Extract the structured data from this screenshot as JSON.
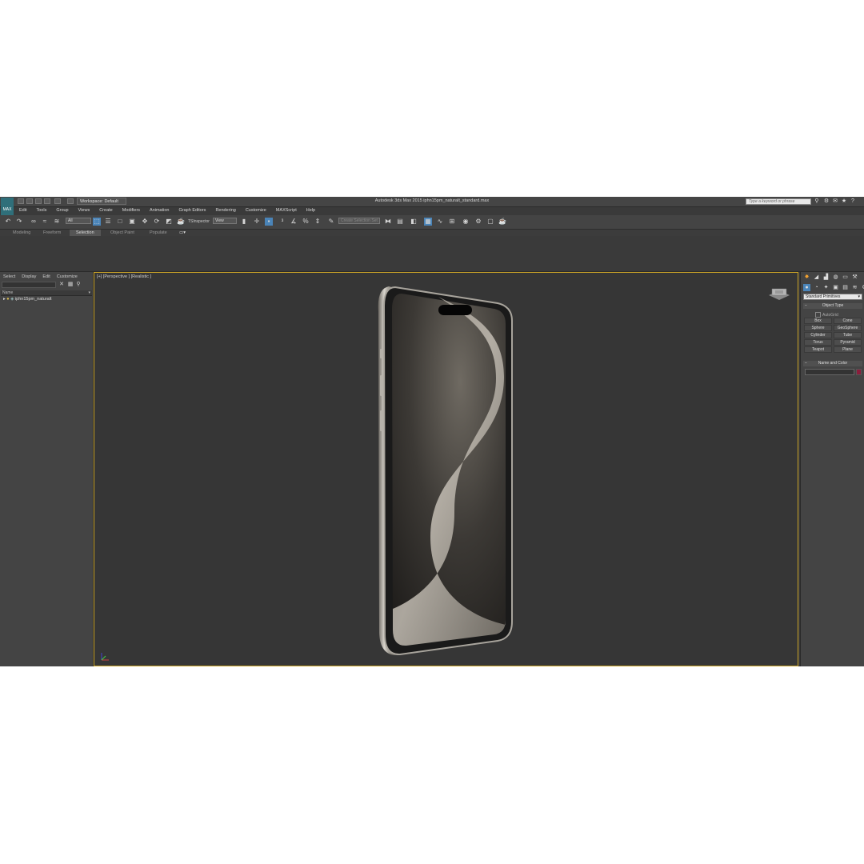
{
  "app": {
    "logo_label": "MAX",
    "window_title": "Autodesk 3ds Max  2015    iphn15pm_naturalt_standard.max",
    "workspace": "Workspace: Default",
    "search_placeholder": "Type a keyword or phrase"
  },
  "menu": [
    "Edit",
    "Tools",
    "Group",
    "Views",
    "Create",
    "Modifiers",
    "Animation",
    "Graph Editors",
    "Rendering",
    "Customize",
    "MAXScript",
    "Help"
  ],
  "toolbar": {
    "filter_value": "All",
    "ts_label": "TSInspector",
    "ref_coord_value": "View",
    "named_selection_placeholder": "Create Selection Set"
  },
  "ribbon_tabs": [
    {
      "label": "Modeling",
      "active": false
    },
    {
      "label": "Freeform",
      "active": false
    },
    {
      "label": "Selection",
      "active": true
    },
    {
      "label": "Object Paint",
      "active": false
    },
    {
      "label": "Populate",
      "active": false
    }
  ],
  "explorer": {
    "menu": [
      "Select",
      "Display",
      "Edit",
      "Customize"
    ],
    "column_header": "Name",
    "items": [
      {
        "label": "iphn15pm_naturalt"
      }
    ]
  },
  "viewport": {
    "label": "[+] [Perspective ] [Realistic ]"
  },
  "command_panel": {
    "category_dropdown": "Standard Primitives",
    "object_type_title": "Object Type",
    "autogrid_label": "AutoGrid",
    "primitives": [
      "Box",
      "Cone",
      "Sphere",
      "GeoSphere",
      "Cylinder",
      "Tube",
      "Torus",
      "Pyramid",
      "Teapot",
      "Plane"
    ],
    "name_color_title": "Name and Color",
    "color": "#8b1d3c"
  },
  "colors": {
    "viewport_border": "#c9a227",
    "active_tool": "#4a84b8"
  }
}
